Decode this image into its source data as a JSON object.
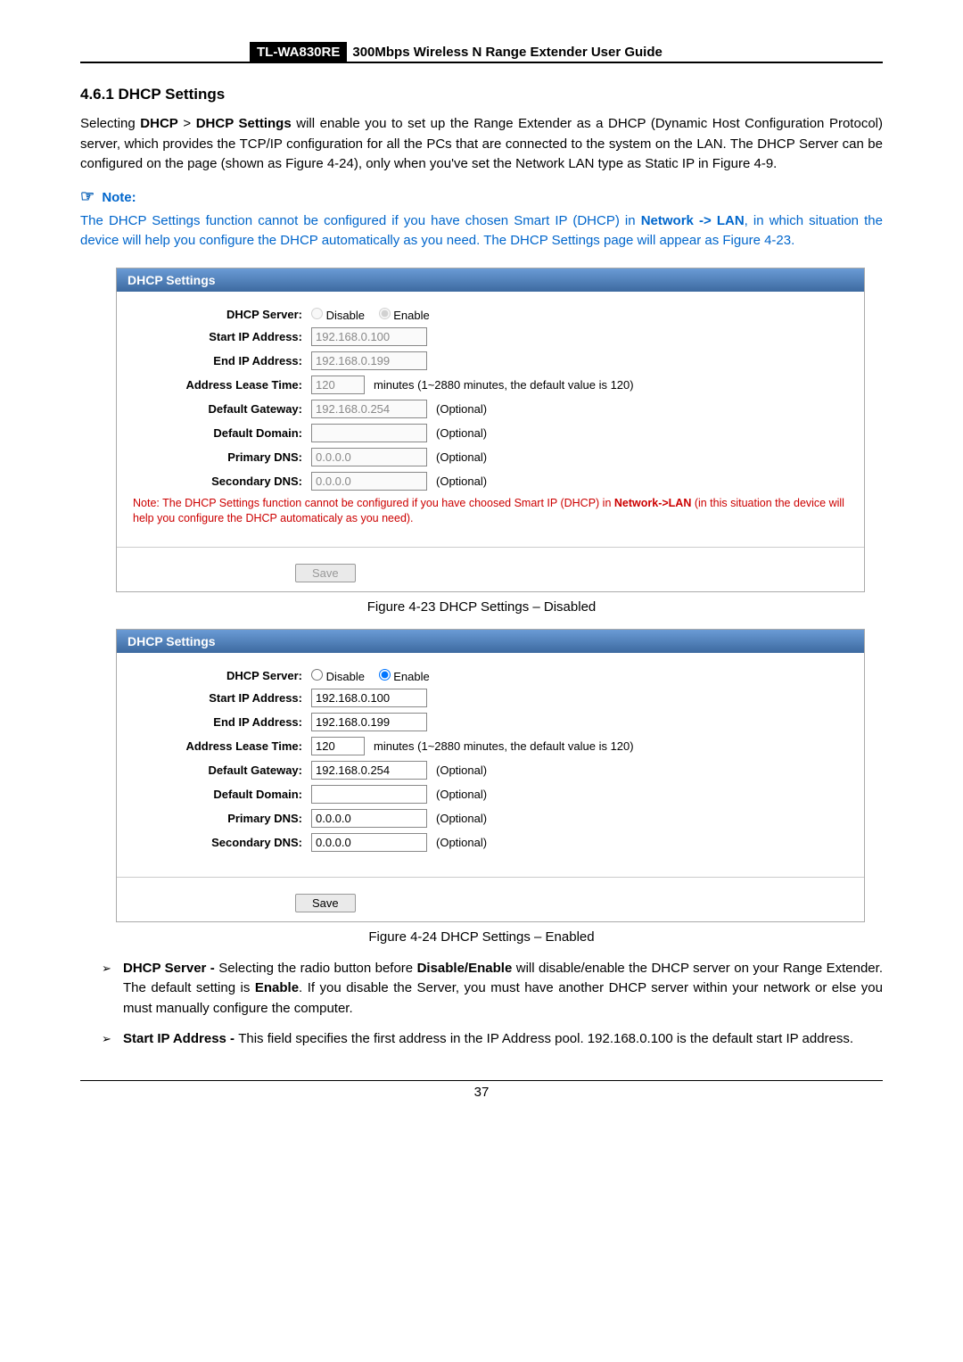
{
  "header": {
    "model": "TL-WA830RE",
    "title": "300Mbps Wireless N Range Extender User Guide"
  },
  "section": {
    "heading": "4.6.1  DHCP Settings"
  },
  "intro": {
    "p1a": "Selecting ",
    "p1b": " > ",
    "p1c": " will enable you to set up the Range Extender as a DHCP (Dynamic Host Configuration Protocol) server, which provides the TCP/IP configuration for all the PCs that are connected to the system on the LAN. The DHCP Server can be configured on the page (shown as Figure 4-24), only when you've set the Network LAN type as Static IP in Figure 4-9.",
    "bold_dhcp": "DHCP",
    "bold_dhcp_settings": "DHCP Settings"
  },
  "note": {
    "label": "Note:",
    "body_a": "The DHCP Settings function cannot be configured if you have chosen Smart IP (DHCP) in ",
    "body_link": "Network -> LAN",
    "body_b": ", in which situation the device will help you configure the DHCP automatically as you need. The DHCP Settings page will appear as Figure 4-23."
  },
  "panel1": {
    "title": "DHCP Settings",
    "rows": {
      "server_label": "DHCP Server:",
      "disable": "Disable",
      "enable": "Enable",
      "start_label": "Start IP Address:",
      "start_value": "192.168.0.100",
      "end_label": "End IP Address:",
      "end_value": "192.168.0.199",
      "lease_label": "Address Lease Time:",
      "lease_value": "120",
      "lease_suffix": "minutes (1~2880 minutes, the default value is 120)",
      "gw_label": "Default Gateway:",
      "gw_value": "192.168.0.254",
      "optional": "(Optional)",
      "domain_label": "Default Domain:",
      "pdns_label": "Primary DNS:",
      "pdns_value": "0.0.0.0",
      "sdns_label": "Secondary DNS:",
      "sdns_value": "0.0.0.0"
    },
    "note_a": "Note: The DHCP Settings function cannot be configured if you have choosed Smart IP (DHCP) in ",
    "note_bold": "Network->LAN",
    "note_b": " (in this situation the device will help you configure the DHCP automaticaly as you need).",
    "save": "Save"
  },
  "fig1_caption": "Figure 4-23 DHCP Settings – Disabled",
  "panel2": {
    "title": "DHCP Settings",
    "rows": {
      "server_label": "DHCP Server:",
      "disable": "Disable",
      "enable": "Enable",
      "start_label": "Start IP Address:",
      "start_value": "192.168.0.100",
      "end_label": "End IP Address:",
      "end_value": "192.168.0.199",
      "lease_label": "Address Lease Time:",
      "lease_value": "120",
      "lease_suffix": "minutes (1~2880 minutes, the default value is 120)",
      "gw_label": "Default Gateway:",
      "gw_value": "192.168.0.254",
      "optional": "(Optional)",
      "domain_label": "Default Domain:",
      "pdns_label": "Primary DNS:",
      "pdns_value": "0.0.0.0",
      "sdns_label": "Secondary DNS:",
      "sdns_value": "0.0.0.0"
    },
    "save": "Save"
  },
  "fig2_caption": "Figure 4-24 DHCP Settings – Enabled",
  "bullets": {
    "b1_title": "DHCP Server - ",
    "b1_body_a": "Selecting the radio button before ",
    "b1_bold1": "Disable/Enable",
    "b1_body_b": " will disable/enable the DHCP server on your Range Extender. The default setting is ",
    "b1_bold2": "Enable",
    "b1_body_c": ". If you disable the Server, you must have another DHCP server within your network or else you must manually configure the computer.",
    "b2_title": "Start IP Address - ",
    "b2_body": "This field specifies the first address in the IP Address pool. 192.168.0.100 is the default start IP address."
  },
  "pagenum": "37"
}
